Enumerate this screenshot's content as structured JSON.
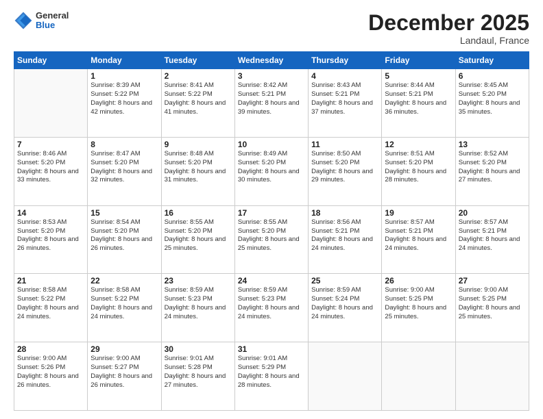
{
  "header": {
    "logo": {
      "line1": "General",
      "line2": "Blue"
    },
    "title": "December 2025",
    "location": "Landaul, France"
  },
  "weekdays": [
    "Sunday",
    "Monday",
    "Tuesday",
    "Wednesday",
    "Thursday",
    "Friday",
    "Saturday"
  ],
  "weeks": [
    [
      {
        "day": "",
        "sunrise": "",
        "sunset": "",
        "daylight": ""
      },
      {
        "day": "1",
        "sunrise": "Sunrise: 8:39 AM",
        "sunset": "Sunset: 5:22 PM",
        "daylight": "Daylight: 8 hours and 42 minutes."
      },
      {
        "day": "2",
        "sunrise": "Sunrise: 8:41 AM",
        "sunset": "Sunset: 5:22 PM",
        "daylight": "Daylight: 8 hours and 41 minutes."
      },
      {
        "day": "3",
        "sunrise": "Sunrise: 8:42 AM",
        "sunset": "Sunset: 5:21 PM",
        "daylight": "Daylight: 8 hours and 39 minutes."
      },
      {
        "day": "4",
        "sunrise": "Sunrise: 8:43 AM",
        "sunset": "Sunset: 5:21 PM",
        "daylight": "Daylight: 8 hours and 37 minutes."
      },
      {
        "day": "5",
        "sunrise": "Sunrise: 8:44 AM",
        "sunset": "Sunset: 5:21 PM",
        "daylight": "Daylight: 8 hours and 36 minutes."
      },
      {
        "day": "6",
        "sunrise": "Sunrise: 8:45 AM",
        "sunset": "Sunset: 5:20 PM",
        "daylight": "Daylight: 8 hours and 35 minutes."
      }
    ],
    [
      {
        "day": "7",
        "sunrise": "Sunrise: 8:46 AM",
        "sunset": "Sunset: 5:20 PM",
        "daylight": "Daylight: 8 hours and 33 minutes."
      },
      {
        "day": "8",
        "sunrise": "Sunrise: 8:47 AM",
        "sunset": "Sunset: 5:20 PM",
        "daylight": "Daylight: 8 hours and 32 minutes."
      },
      {
        "day": "9",
        "sunrise": "Sunrise: 8:48 AM",
        "sunset": "Sunset: 5:20 PM",
        "daylight": "Daylight: 8 hours and 31 minutes."
      },
      {
        "day": "10",
        "sunrise": "Sunrise: 8:49 AM",
        "sunset": "Sunset: 5:20 PM",
        "daylight": "Daylight: 8 hours and 30 minutes."
      },
      {
        "day": "11",
        "sunrise": "Sunrise: 8:50 AM",
        "sunset": "Sunset: 5:20 PM",
        "daylight": "Daylight: 8 hours and 29 minutes."
      },
      {
        "day": "12",
        "sunrise": "Sunrise: 8:51 AM",
        "sunset": "Sunset: 5:20 PM",
        "daylight": "Daylight: 8 hours and 28 minutes."
      },
      {
        "day": "13",
        "sunrise": "Sunrise: 8:52 AM",
        "sunset": "Sunset: 5:20 PM",
        "daylight": "Daylight: 8 hours and 27 minutes."
      }
    ],
    [
      {
        "day": "14",
        "sunrise": "Sunrise: 8:53 AM",
        "sunset": "Sunset: 5:20 PM",
        "daylight": "Daylight: 8 hours and 26 minutes."
      },
      {
        "day": "15",
        "sunrise": "Sunrise: 8:54 AM",
        "sunset": "Sunset: 5:20 PM",
        "daylight": "Daylight: 8 hours and 26 minutes."
      },
      {
        "day": "16",
        "sunrise": "Sunrise: 8:55 AM",
        "sunset": "Sunset: 5:20 PM",
        "daylight": "Daylight: 8 hours and 25 minutes."
      },
      {
        "day": "17",
        "sunrise": "Sunrise: 8:55 AM",
        "sunset": "Sunset: 5:20 PM",
        "daylight": "Daylight: 8 hours and 25 minutes."
      },
      {
        "day": "18",
        "sunrise": "Sunrise: 8:56 AM",
        "sunset": "Sunset: 5:21 PM",
        "daylight": "Daylight: 8 hours and 24 minutes."
      },
      {
        "day": "19",
        "sunrise": "Sunrise: 8:57 AM",
        "sunset": "Sunset: 5:21 PM",
        "daylight": "Daylight: 8 hours and 24 minutes."
      },
      {
        "day": "20",
        "sunrise": "Sunrise: 8:57 AM",
        "sunset": "Sunset: 5:21 PM",
        "daylight": "Daylight: 8 hours and 24 minutes."
      }
    ],
    [
      {
        "day": "21",
        "sunrise": "Sunrise: 8:58 AM",
        "sunset": "Sunset: 5:22 PM",
        "daylight": "Daylight: 8 hours and 24 minutes."
      },
      {
        "day": "22",
        "sunrise": "Sunrise: 8:58 AM",
        "sunset": "Sunset: 5:22 PM",
        "daylight": "Daylight: 8 hours and 24 minutes."
      },
      {
        "day": "23",
        "sunrise": "Sunrise: 8:59 AM",
        "sunset": "Sunset: 5:23 PM",
        "daylight": "Daylight: 8 hours and 24 minutes."
      },
      {
        "day": "24",
        "sunrise": "Sunrise: 8:59 AM",
        "sunset": "Sunset: 5:23 PM",
        "daylight": "Daylight: 8 hours and 24 minutes."
      },
      {
        "day": "25",
        "sunrise": "Sunrise: 8:59 AM",
        "sunset": "Sunset: 5:24 PM",
        "daylight": "Daylight: 8 hours and 24 minutes."
      },
      {
        "day": "26",
        "sunrise": "Sunrise: 9:00 AM",
        "sunset": "Sunset: 5:25 PM",
        "daylight": "Daylight: 8 hours and 25 minutes."
      },
      {
        "day": "27",
        "sunrise": "Sunrise: 9:00 AM",
        "sunset": "Sunset: 5:25 PM",
        "daylight": "Daylight: 8 hours and 25 minutes."
      }
    ],
    [
      {
        "day": "28",
        "sunrise": "Sunrise: 9:00 AM",
        "sunset": "Sunset: 5:26 PM",
        "daylight": "Daylight: 8 hours and 26 minutes."
      },
      {
        "day": "29",
        "sunrise": "Sunrise: 9:00 AM",
        "sunset": "Sunset: 5:27 PM",
        "daylight": "Daylight: 8 hours and 26 minutes."
      },
      {
        "day": "30",
        "sunrise": "Sunrise: 9:01 AM",
        "sunset": "Sunset: 5:28 PM",
        "daylight": "Daylight: 8 hours and 27 minutes."
      },
      {
        "day": "31",
        "sunrise": "Sunrise: 9:01 AM",
        "sunset": "Sunset: 5:29 PM",
        "daylight": "Daylight: 8 hours and 28 minutes."
      },
      {
        "day": "",
        "sunrise": "",
        "sunset": "",
        "daylight": ""
      },
      {
        "day": "",
        "sunrise": "",
        "sunset": "",
        "daylight": ""
      },
      {
        "day": "",
        "sunrise": "",
        "sunset": "",
        "daylight": ""
      }
    ]
  ]
}
